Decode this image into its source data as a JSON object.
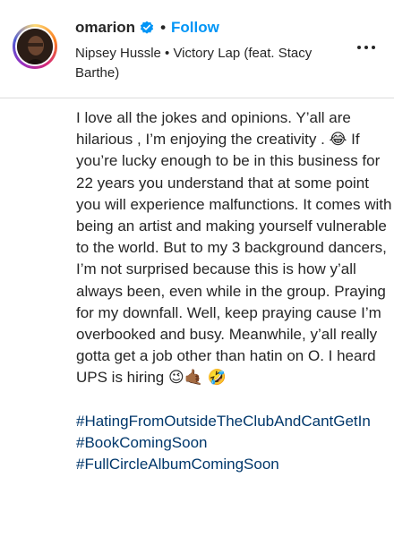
{
  "post": {
    "author": {
      "username": "omarion",
      "verified_icon": "verified-badge-icon",
      "separator": "•",
      "follow_label": "Follow"
    },
    "audio": "Nipsey Hussle • Victory Lap (feat. Stacy Barthe)",
    "more_icon": "more-options-icon"
  },
  "caption": {
    "body": "I love all the jokes and opinions. Y’all are hilarious , I’m enjoying the creativity . 😂 If you’re lucky enough to be in this business for 22 years you understand that at some point you will experience malfunctions. It comes with being an artist and making yourself vulnerable to the world. But to my 3 background dancers, I’m not surprised because this is how y’all always been, even while in the group. Praying for my downfall. Well, keep praying cause I’m overbooked and busy. Meanwhile, y’all really gotta get a job other than hatin on O. I heard UPS is hiring 😉🤙🏾 🤣",
    "hashtags": [
      "#HatingFromOutsideTheClubAndCantGetIn",
      "#BookComingSoon",
      "#FullCircleAlbumComingSoon"
    ]
  },
  "colors": {
    "link_blue": "#0095f6",
    "hashtag_blue": "#00376b",
    "text": "#262626",
    "divider": "#dbdbdb"
  }
}
